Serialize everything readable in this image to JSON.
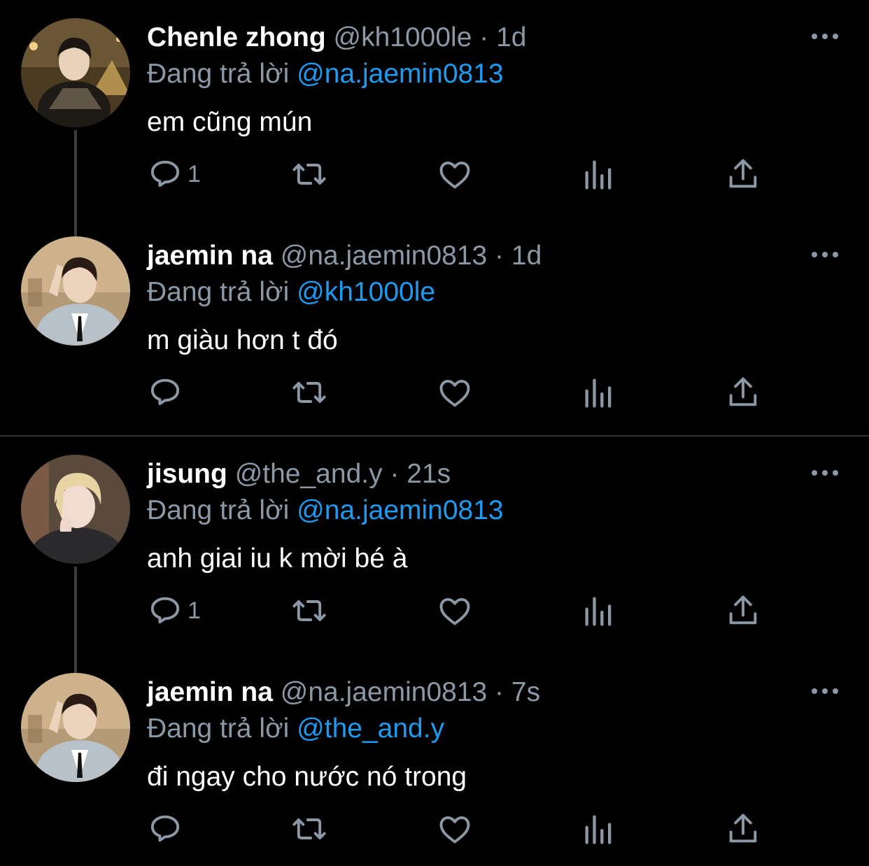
{
  "colors": {
    "background": "#000000",
    "text_primary": "#ffffff",
    "text_secondary": "#8b98a5",
    "mention": "#1d9bf0",
    "divider": "#2f3336"
  },
  "tweets": [
    {
      "name": "Chenle zhong",
      "handle": "@kh1000le",
      "dot": "·",
      "time": "1d",
      "replying_prefix": "Đang trả lời",
      "replying_to": "@na.jaemin0813",
      "text": "em cũng mún",
      "reply_count": "1"
    },
    {
      "name": "jaemin na",
      "handle": "@na.jaemin0813",
      "dot": "·",
      "time": "1d",
      "replying_prefix": "Đang trả lời",
      "replying_to": "@kh1000le",
      "text": "m giàu hơn t đó",
      "reply_count": ""
    },
    {
      "name": "jisung",
      "handle": "@the_and.y",
      "dot": "·",
      "time": "21s",
      "replying_prefix": "Đang trả lời",
      "replying_to": "@na.jaemin0813",
      "text": "anh giai iu k mời bé à",
      "reply_count": "1"
    },
    {
      "name": "jaemin na",
      "handle": "@na.jaemin0813",
      "dot": "·",
      "time": "7s",
      "replying_prefix": "Đang trả lời",
      "replying_to": "@the_and.y",
      "text": "đi ngay cho nước nó trong",
      "reply_count": ""
    }
  ],
  "icons": {
    "reply": "reply-icon",
    "retweet": "retweet-icon",
    "like": "heart-icon",
    "views": "views-icon",
    "share": "share-icon",
    "more": "more-icon"
  }
}
